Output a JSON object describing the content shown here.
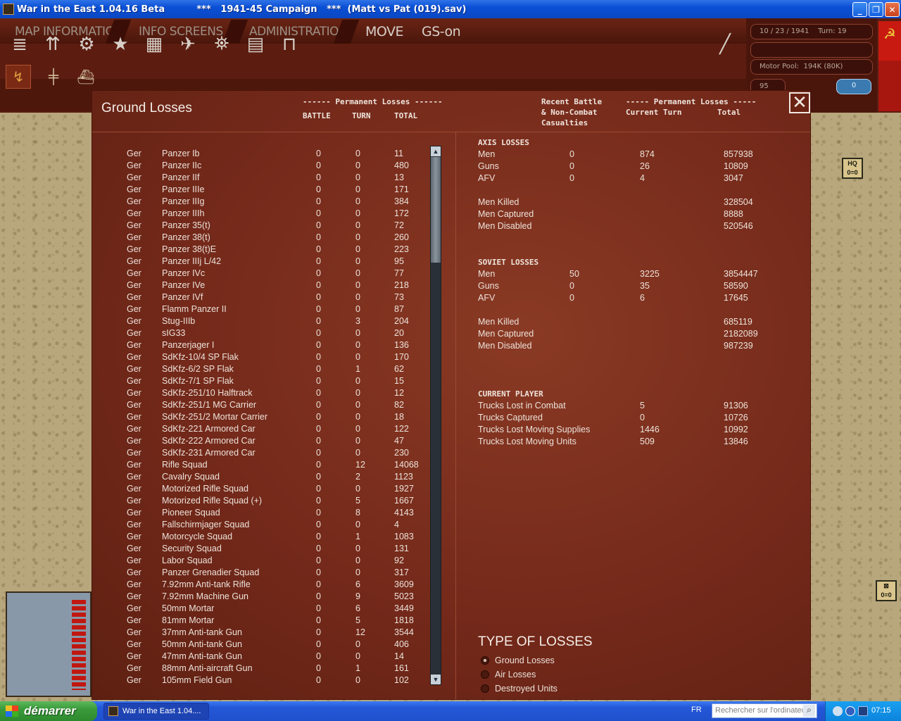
{
  "window": {
    "title": "War in the East 1.04.16 Beta          ***   1941-45 Campaign   ***  (Matt vs Pat (019).sav)",
    "minimize": "_",
    "maximize": "❐",
    "close": "✕"
  },
  "menu": {
    "items": [
      "MAP INFORMATION",
      "INFO SCREENS",
      "ADMINISTRATION"
    ],
    "mode": "MOVE",
    "gs": "GS-on"
  },
  "info": {
    "date_turn": "10 / 23 / 1941    Turn: 19",
    "motor_pool": "Motor Pool:  194K (80K)",
    "small_value": "95",
    "toggle_value": "0"
  },
  "map_counters": {
    "hq": "HQ",
    "hq_strength": "0=0",
    "inf_strength": "0=0"
  },
  "dialog": {
    "title": "Ground Losses",
    "close": "✕",
    "left_header": {
      "group": "------ Permanent Losses ------",
      "battle": "BATTLE",
      "turn": "TURN",
      "total": "TOTAL"
    },
    "right_header": {
      "recent": "Recent Battle\n& Non-Combat\nCasualties",
      "group": "----- Permanent Losses -----",
      "current_turn": "Current Turn",
      "total": "Total"
    },
    "ground_losses": [
      {
        "side": "Ger",
        "name": "Panzer Ib",
        "battle": "0",
        "turn": "0",
        "total": "11"
      },
      {
        "side": "Ger",
        "name": "Panzer IIc",
        "battle": "0",
        "turn": "0",
        "total": "480"
      },
      {
        "side": "Ger",
        "name": "Panzer IIf",
        "battle": "0",
        "turn": "0",
        "total": "13"
      },
      {
        "side": "Ger",
        "name": "Panzer IIIe",
        "battle": "0",
        "turn": "0",
        "total": "171"
      },
      {
        "side": "Ger",
        "name": "Panzer IIIg",
        "battle": "0",
        "turn": "0",
        "total": "384"
      },
      {
        "side": "Ger",
        "name": "Panzer IIIh",
        "battle": "0",
        "turn": "0",
        "total": "172"
      },
      {
        "side": "Ger",
        "name": "Panzer 35(t)",
        "battle": "0",
        "turn": "0",
        "total": "72"
      },
      {
        "side": "Ger",
        "name": "Panzer 38(t)",
        "battle": "0",
        "turn": "0",
        "total": "260"
      },
      {
        "side": "Ger",
        "name": "Panzer 38(t)E",
        "battle": "0",
        "turn": "0",
        "total": "223"
      },
      {
        "side": "Ger",
        "name": "Panzer IIIj L/42",
        "battle": "0",
        "turn": "0",
        "total": "95"
      },
      {
        "side": "Ger",
        "name": "Panzer IVc",
        "battle": "0",
        "turn": "0",
        "total": "77"
      },
      {
        "side": "Ger",
        "name": "Panzer IVe",
        "battle": "0",
        "turn": "0",
        "total": "218"
      },
      {
        "side": "Ger",
        "name": "Panzer IVf",
        "battle": "0",
        "turn": "0",
        "total": "73"
      },
      {
        "side": "Ger",
        "name": "Flamm Panzer II",
        "battle": "0",
        "turn": "0",
        "total": "87"
      },
      {
        "side": "Ger",
        "name": "Stug-IIIb",
        "battle": "0",
        "turn": "3",
        "total": "204"
      },
      {
        "side": "Ger",
        "name": "sIG33",
        "battle": "0",
        "turn": "0",
        "total": "20"
      },
      {
        "side": "Ger",
        "name": "Panzerjager I",
        "battle": "0",
        "turn": "0",
        "total": "136"
      },
      {
        "side": "Ger",
        "name": "SdKfz-10/4 SP Flak",
        "battle": "0",
        "turn": "0",
        "total": "170"
      },
      {
        "side": "Ger",
        "name": "SdKfz-6/2 SP Flak",
        "battle": "0",
        "turn": "1",
        "total": "62"
      },
      {
        "side": "Ger",
        "name": "SdKfz-7/1 SP Flak",
        "battle": "0",
        "turn": "0",
        "total": "15"
      },
      {
        "side": "Ger",
        "name": "SdKfz-251/10 Halftrack",
        "battle": "0",
        "turn": "0",
        "total": "12"
      },
      {
        "side": "Ger",
        "name": "SdKfz-251/1 MG Carrier",
        "battle": "0",
        "turn": "0",
        "total": "82"
      },
      {
        "side": "Ger",
        "name": "SdKfz-251/2 Mortar Carrier",
        "battle": "0",
        "turn": "0",
        "total": "18"
      },
      {
        "side": "Ger",
        "name": "SdKfz-221 Armored Car",
        "battle": "0",
        "turn": "0",
        "total": "122"
      },
      {
        "side": "Ger",
        "name": "SdKfz-222 Armored Car",
        "battle": "0",
        "turn": "0",
        "total": "47"
      },
      {
        "side": "Ger",
        "name": "SdKfz-231 Armored Car",
        "battle": "0",
        "turn": "0",
        "total": "230"
      },
      {
        "side": "Ger",
        "name": "Rifle Squad",
        "battle": "0",
        "turn": "12",
        "total": "14068"
      },
      {
        "side": "Ger",
        "name": "Cavalry Squad",
        "battle": "0",
        "turn": "2",
        "total": "1123"
      },
      {
        "side": "Ger",
        "name": "Motorized Rifle Squad",
        "battle": "0",
        "turn": "0",
        "total": "1927"
      },
      {
        "side": "Ger",
        "name": "Motorized Rifle Squad (+)",
        "battle": "0",
        "turn": "5",
        "total": "1667"
      },
      {
        "side": "Ger",
        "name": "Pioneer Squad",
        "battle": "0",
        "turn": "8",
        "total": "4143"
      },
      {
        "side": "Ger",
        "name": "Fallschirmjager Squad",
        "battle": "0",
        "turn": "0",
        "total": "4"
      },
      {
        "side": "Ger",
        "name": "Motorcycle Squad",
        "battle": "0",
        "turn": "1",
        "total": "1083"
      },
      {
        "side": "Ger",
        "name": "Security Squad",
        "battle": "0",
        "turn": "0",
        "total": "131"
      },
      {
        "side": "Ger",
        "name": "Labor Squad",
        "battle": "0",
        "turn": "0",
        "total": "92"
      },
      {
        "side": "Ger",
        "name": "Panzer Grenadier Squad",
        "battle": "0",
        "turn": "0",
        "total": "317"
      },
      {
        "side": "Ger",
        "name": "7.92mm Anti-tank Rifle",
        "battle": "0",
        "turn": "6",
        "total": "3609"
      },
      {
        "side": "Ger",
        "name": "7.92mm Machine Gun",
        "battle": "0",
        "turn": "9",
        "total": "5023"
      },
      {
        "side": "Ger",
        "name": "50mm Mortar",
        "battle": "0",
        "turn": "6",
        "total": "3449"
      },
      {
        "side": "Ger",
        "name": "81mm Mortar",
        "battle": "0",
        "turn": "5",
        "total": "1818"
      },
      {
        "side": "Ger",
        "name": "37mm Anti-tank Gun",
        "battle": "0",
        "turn": "12",
        "total": "3544"
      },
      {
        "side": "Ger",
        "name": "50mm Anti-tank Gun",
        "battle": "0",
        "turn": "0",
        "total": "406"
      },
      {
        "side": "Ger",
        "name": "47mm Anti-tank Gun",
        "battle": "0",
        "turn": "0",
        "total": "14"
      },
      {
        "side": "Ger",
        "name": "88mm Anti-aircraft Gun",
        "battle": "0",
        "turn": "1",
        "total": "161"
      },
      {
        "side": "Ger",
        "name": "105mm Field Gun",
        "battle": "0",
        "turn": "0",
        "total": "102"
      }
    ],
    "axis": {
      "title": "AXIS LOSSES",
      "rows": [
        {
          "label": "Men",
          "recent": "0",
          "turn": "874",
          "total": "857938"
        },
        {
          "label": "Guns",
          "recent": "0",
          "turn": "26",
          "total": "10809"
        },
        {
          "label": "AFV",
          "recent": "0",
          "turn": "4",
          "total": "3047"
        }
      ],
      "detail": [
        {
          "label": "Men Killed",
          "total": "328504"
        },
        {
          "label": "Men Captured",
          "total": "8888"
        },
        {
          "label": "Men Disabled",
          "total": "520546"
        }
      ]
    },
    "soviet": {
      "title": "SOVIET LOSSES",
      "rows": [
        {
          "label": "Men",
          "recent": "50",
          "turn": "3225",
          "total": "3854447"
        },
        {
          "label": "Guns",
          "recent": "0",
          "turn": "35",
          "total": "58590"
        },
        {
          "label": "AFV",
          "recent": "0",
          "turn": "6",
          "total": "17645"
        }
      ],
      "detail": [
        {
          "label": "Men Killed",
          "total": "685119"
        },
        {
          "label": "Men Captured",
          "total": "2182089"
        },
        {
          "label": "Men Disabled",
          "total": "987239"
        }
      ]
    },
    "current_player": {
      "title": "CURRENT PLAYER",
      "rows": [
        {
          "label": "Trucks Lost in Combat",
          "turn": "5",
          "total": "91306"
        },
        {
          "label": "Trucks Captured",
          "turn": "0",
          "total": "10726"
        },
        {
          "label": "Trucks Lost Moving Supplies",
          "turn": "1446",
          "total": "10992"
        },
        {
          "label": "Trucks Lost Moving Units",
          "turn": "509",
          "total": "13846"
        }
      ]
    },
    "type_of_losses": {
      "title": "TYPE OF LOSSES",
      "options": [
        "Ground Losses",
        "Air Losses",
        "Destroyed Units"
      ],
      "selected": "Ground Losses"
    }
  },
  "taskbar": {
    "start": "démarrer",
    "task": "War in the East 1.04....",
    "lang": "FR",
    "search_placeholder": "Rechercher sur l'ordinateur",
    "clock": "07:15"
  },
  "colors": {
    "dialog_bg": "#7a2e1c",
    "gamebar_bg": "#5a1e12",
    "map_bg": "#b8a67c",
    "xp_blue": "#245edb",
    "start_green": "#3a9a3a"
  }
}
